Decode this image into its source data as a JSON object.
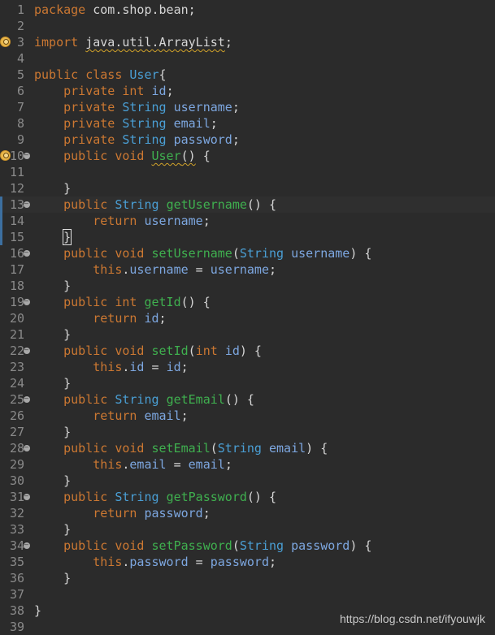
{
  "editor": {
    "lines": [
      {
        "n": "1",
        "tokens": [
          {
            "t": "package",
            "c": "kw"
          },
          {
            "t": " com.shop.bean;",
            "c": "plain"
          }
        ]
      },
      {
        "n": "2",
        "tokens": []
      },
      {
        "n": "3",
        "warn": true,
        "tokens": [
          {
            "t": "import",
            "c": "kw"
          },
          {
            "t": " ",
            "c": "plain"
          },
          {
            "t": "java.util.ArrayList",
            "c": "plain",
            "squig": true
          },
          {
            "t": ";",
            "c": "plain"
          }
        ]
      },
      {
        "n": "4",
        "tokens": []
      },
      {
        "n": "5",
        "tokens": [
          {
            "t": "public",
            "c": "kw"
          },
          {
            "t": " ",
            "c": "plain"
          },
          {
            "t": "class",
            "c": "kw"
          },
          {
            "t": " ",
            "c": "plain"
          },
          {
            "t": "User",
            "c": "cls"
          },
          {
            "t": "{",
            "c": "plain"
          }
        ]
      },
      {
        "n": "6",
        "tokens": [
          {
            "t": "    private",
            "c": "kw"
          },
          {
            "t": " ",
            "c": "plain"
          },
          {
            "t": "int",
            "c": "kw"
          },
          {
            "t": " ",
            "c": "plain"
          },
          {
            "t": "id",
            "c": "fld"
          },
          {
            "t": ";",
            "c": "plain"
          }
        ]
      },
      {
        "n": "7",
        "tokens": [
          {
            "t": "    private",
            "c": "kw"
          },
          {
            "t": " ",
            "c": "plain"
          },
          {
            "t": "String",
            "c": "ty"
          },
          {
            "t": " ",
            "c": "plain"
          },
          {
            "t": "username",
            "c": "fld"
          },
          {
            "t": ";",
            "c": "plain"
          }
        ]
      },
      {
        "n": "8",
        "tokens": [
          {
            "t": "    private",
            "c": "kw"
          },
          {
            "t": " ",
            "c": "plain"
          },
          {
            "t": "String",
            "c": "ty"
          },
          {
            "t": " ",
            "c": "plain"
          },
          {
            "t": "email",
            "c": "fld"
          },
          {
            "t": ";",
            "c": "plain"
          }
        ]
      },
      {
        "n": "9",
        "tokens": [
          {
            "t": "    private",
            "c": "kw"
          },
          {
            "t": " ",
            "c": "plain"
          },
          {
            "t": "String",
            "c": "ty"
          },
          {
            "t": " ",
            "c": "plain"
          },
          {
            "t": "password",
            "c": "fld"
          },
          {
            "t": ";",
            "c": "plain"
          }
        ]
      },
      {
        "n": "10",
        "warn": true,
        "fold": true,
        "tokens": [
          {
            "t": "    public",
            "c": "kw"
          },
          {
            "t": " ",
            "c": "plain"
          },
          {
            "t": "void",
            "c": "kw"
          },
          {
            "t": " ",
            "c": "plain"
          },
          {
            "t": "User",
            "c": "mth",
            "squig": true
          },
          {
            "t": "()",
            "c": "plain",
            "squig": true
          },
          {
            "t": " {",
            "c": "plain"
          }
        ]
      },
      {
        "n": "11",
        "tokens": []
      },
      {
        "n": "12",
        "tokens": [
          {
            "t": "    }",
            "c": "plain"
          }
        ]
      },
      {
        "n": "13",
        "fold": true,
        "marker": true,
        "current": true,
        "tokens": [
          {
            "t": "    public",
            "c": "kw"
          },
          {
            "t": " ",
            "c": "plain"
          },
          {
            "t": "String",
            "c": "ty"
          },
          {
            "t": " ",
            "c": "plain"
          },
          {
            "t": "getUsername",
            "c": "mth"
          },
          {
            "t": "() {",
            "c": "plain"
          }
        ]
      },
      {
        "n": "14",
        "marker": true,
        "tokens": [
          {
            "t": "        return",
            "c": "kw"
          },
          {
            "t": " ",
            "c": "plain"
          },
          {
            "t": "username",
            "c": "fld"
          },
          {
            "t": ";",
            "c": "plain"
          }
        ]
      },
      {
        "n": "15",
        "marker": true,
        "caret": true,
        "tokens": [
          {
            "t": "    ",
            "c": "plain"
          },
          {
            "t": "}",
            "c": "plain",
            "caret": true
          }
        ]
      },
      {
        "n": "16",
        "fold": true,
        "tokens": [
          {
            "t": "    public",
            "c": "kw"
          },
          {
            "t": " ",
            "c": "plain"
          },
          {
            "t": "void",
            "c": "kw"
          },
          {
            "t": " ",
            "c": "plain"
          },
          {
            "t": "setUsername",
            "c": "mth"
          },
          {
            "t": "(",
            "c": "plain"
          },
          {
            "t": "String",
            "c": "ty"
          },
          {
            "t": " ",
            "c": "plain"
          },
          {
            "t": "username",
            "c": "par"
          },
          {
            "t": ") {",
            "c": "plain"
          }
        ]
      },
      {
        "n": "17",
        "tokens": [
          {
            "t": "        this",
            "c": "kw"
          },
          {
            "t": ".",
            "c": "plain"
          },
          {
            "t": "username",
            "c": "fld"
          },
          {
            "t": " = ",
            "c": "plain"
          },
          {
            "t": "username",
            "c": "par"
          },
          {
            "t": ";",
            "c": "plain"
          }
        ]
      },
      {
        "n": "18",
        "tokens": [
          {
            "t": "    }",
            "c": "plain"
          }
        ]
      },
      {
        "n": "19",
        "fold": true,
        "tokens": [
          {
            "t": "    public",
            "c": "kw"
          },
          {
            "t": " ",
            "c": "plain"
          },
          {
            "t": "int",
            "c": "kw"
          },
          {
            "t": " ",
            "c": "plain"
          },
          {
            "t": "getId",
            "c": "mth"
          },
          {
            "t": "() {",
            "c": "plain"
          }
        ]
      },
      {
        "n": "20",
        "tokens": [
          {
            "t": "        return",
            "c": "kw"
          },
          {
            "t": " ",
            "c": "plain"
          },
          {
            "t": "id",
            "c": "fld"
          },
          {
            "t": ";",
            "c": "plain"
          }
        ]
      },
      {
        "n": "21",
        "tokens": [
          {
            "t": "    }",
            "c": "plain"
          }
        ]
      },
      {
        "n": "22",
        "fold": true,
        "tokens": [
          {
            "t": "    public",
            "c": "kw"
          },
          {
            "t": " ",
            "c": "plain"
          },
          {
            "t": "void",
            "c": "kw"
          },
          {
            "t": " ",
            "c": "plain"
          },
          {
            "t": "setId",
            "c": "mth"
          },
          {
            "t": "(",
            "c": "plain"
          },
          {
            "t": "int",
            "c": "kw"
          },
          {
            "t": " ",
            "c": "plain"
          },
          {
            "t": "id",
            "c": "par"
          },
          {
            "t": ") {",
            "c": "plain"
          }
        ]
      },
      {
        "n": "23",
        "tokens": [
          {
            "t": "        this",
            "c": "kw"
          },
          {
            "t": ".",
            "c": "plain"
          },
          {
            "t": "id",
            "c": "fld"
          },
          {
            "t": " = ",
            "c": "plain"
          },
          {
            "t": "id",
            "c": "par"
          },
          {
            "t": ";",
            "c": "plain"
          }
        ]
      },
      {
        "n": "24",
        "tokens": [
          {
            "t": "    }",
            "c": "plain"
          }
        ]
      },
      {
        "n": "25",
        "fold": true,
        "tokens": [
          {
            "t": "    public",
            "c": "kw"
          },
          {
            "t": " ",
            "c": "plain"
          },
          {
            "t": "String",
            "c": "ty"
          },
          {
            "t": " ",
            "c": "plain"
          },
          {
            "t": "getEmail",
            "c": "mth"
          },
          {
            "t": "() {",
            "c": "plain"
          }
        ]
      },
      {
        "n": "26",
        "tokens": [
          {
            "t": "        return",
            "c": "kw"
          },
          {
            "t": " ",
            "c": "plain"
          },
          {
            "t": "email",
            "c": "fld"
          },
          {
            "t": ";",
            "c": "plain"
          }
        ]
      },
      {
        "n": "27",
        "tokens": [
          {
            "t": "    }",
            "c": "plain"
          }
        ]
      },
      {
        "n": "28",
        "fold": true,
        "tokens": [
          {
            "t": "    public",
            "c": "kw"
          },
          {
            "t": " ",
            "c": "plain"
          },
          {
            "t": "void",
            "c": "kw"
          },
          {
            "t": " ",
            "c": "plain"
          },
          {
            "t": "setEmail",
            "c": "mth"
          },
          {
            "t": "(",
            "c": "plain"
          },
          {
            "t": "String",
            "c": "ty"
          },
          {
            "t": " ",
            "c": "plain"
          },
          {
            "t": "email",
            "c": "par"
          },
          {
            "t": ") {",
            "c": "plain"
          }
        ]
      },
      {
        "n": "29",
        "tokens": [
          {
            "t": "        this",
            "c": "kw"
          },
          {
            "t": ".",
            "c": "plain"
          },
          {
            "t": "email",
            "c": "fld"
          },
          {
            "t": " = ",
            "c": "plain"
          },
          {
            "t": "email",
            "c": "par"
          },
          {
            "t": ";",
            "c": "plain"
          }
        ]
      },
      {
        "n": "30",
        "tokens": [
          {
            "t": "    }",
            "c": "plain"
          }
        ]
      },
      {
        "n": "31",
        "fold": true,
        "tokens": [
          {
            "t": "    public",
            "c": "kw"
          },
          {
            "t": " ",
            "c": "plain"
          },
          {
            "t": "String",
            "c": "ty"
          },
          {
            "t": " ",
            "c": "plain"
          },
          {
            "t": "getPassword",
            "c": "mth"
          },
          {
            "t": "() {",
            "c": "plain"
          }
        ]
      },
      {
        "n": "32",
        "tokens": [
          {
            "t": "        return",
            "c": "kw"
          },
          {
            "t": " ",
            "c": "plain"
          },
          {
            "t": "password",
            "c": "fld"
          },
          {
            "t": ";",
            "c": "plain"
          }
        ]
      },
      {
        "n": "33",
        "tokens": [
          {
            "t": "    }",
            "c": "plain"
          }
        ]
      },
      {
        "n": "34",
        "fold": true,
        "tokens": [
          {
            "t": "    public",
            "c": "kw"
          },
          {
            "t": " ",
            "c": "plain"
          },
          {
            "t": "void",
            "c": "kw"
          },
          {
            "t": " ",
            "c": "plain"
          },
          {
            "t": "setPassword",
            "c": "mth"
          },
          {
            "t": "(",
            "c": "plain"
          },
          {
            "t": "String",
            "c": "ty"
          },
          {
            "t": " ",
            "c": "plain"
          },
          {
            "t": "password",
            "c": "par"
          },
          {
            "t": ") {",
            "c": "plain"
          }
        ]
      },
      {
        "n": "35",
        "tokens": [
          {
            "t": "        this",
            "c": "kw"
          },
          {
            "t": ".",
            "c": "plain"
          },
          {
            "t": "password",
            "c": "fld"
          },
          {
            "t": " = ",
            "c": "plain"
          },
          {
            "t": "password",
            "c": "par"
          },
          {
            "t": ";",
            "c": "plain"
          }
        ]
      },
      {
        "n": "36",
        "tokens": [
          {
            "t": "    }",
            "c": "plain"
          }
        ]
      },
      {
        "n": "37",
        "tokens": []
      },
      {
        "n": "38",
        "tokens": [
          {
            "t": "}",
            "c": "plain"
          }
        ]
      },
      {
        "n": "39",
        "tokens": []
      }
    ]
  },
  "watermark": "https://blog.csdn.net/ifyouwjk",
  "colors": {
    "background": "#2b2b2b",
    "keyword": "#cc7832",
    "type": "#4a9fd5",
    "field": "#7da7e0",
    "method": "#3fb04f",
    "line_number": "#8a8a8a"
  },
  "icons": {
    "warning": "warning-icon",
    "fold": "fold-collapse-icon",
    "caret": "text-cursor-icon"
  }
}
